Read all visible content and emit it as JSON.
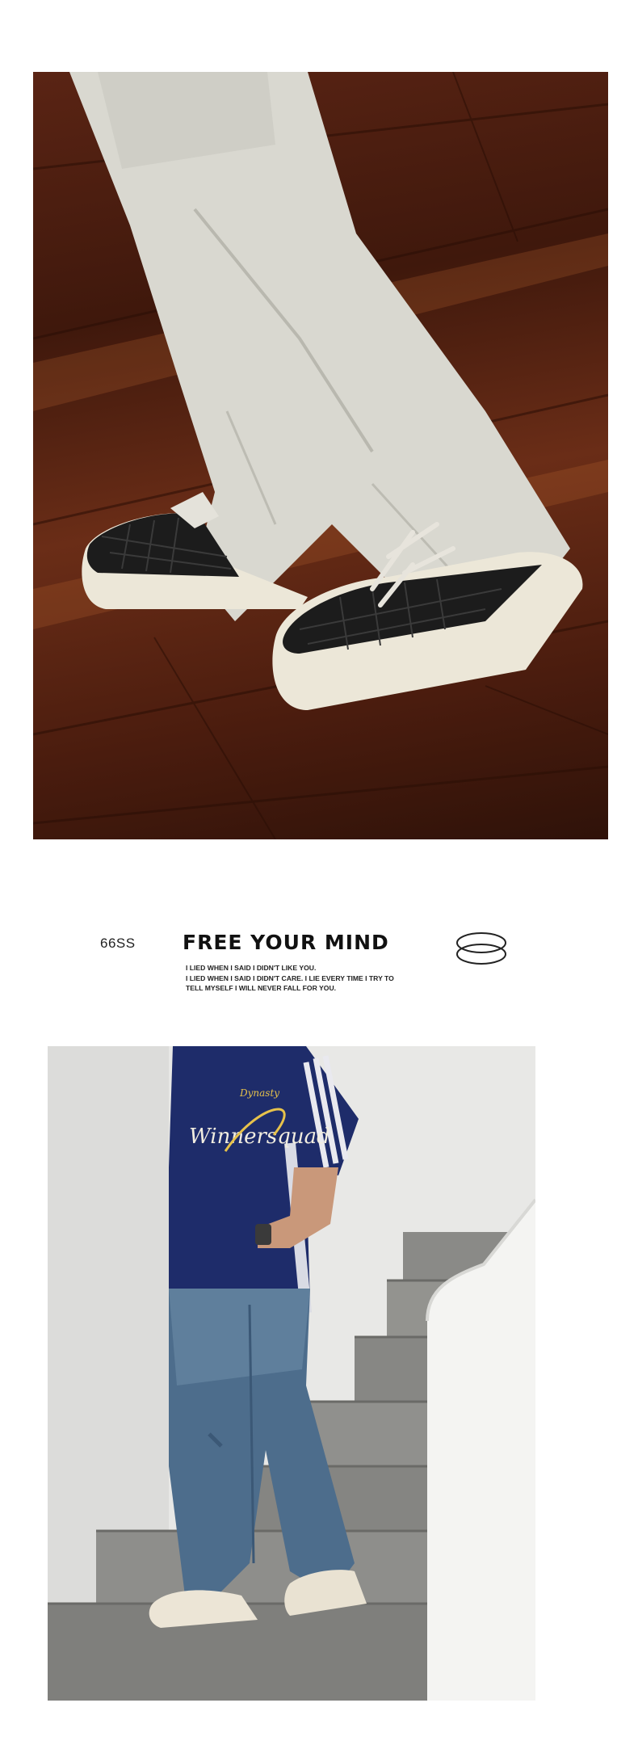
{
  "photos": [
    {
      "subject": "sneakers-photo",
      "alt": ""
    },
    {
      "subject": "stairs-outfit-photo",
      "alt": ""
    }
  ],
  "slogan": {
    "code": "66SS",
    "headline": "FREE YOUR MIND",
    "lines": [
      "I LIED WHEN I SAID I DIDN'T LIKE YOU.",
      "I LIED WHEN I SAID I DIDN'T CARE. I LIE EVERY TIME I TRY TO",
      "TELL MYSELF I WILL NEVER FALL FOR YOU."
    ]
  },
  "shirt_print": {
    "main": "Winnersquad",
    "badge": "Dynasty"
  },
  "colors": {
    "floor": "#4a1c0e",
    "pants_light": "#d9d8d0",
    "shoe_upper": "#1b1b1b",
    "sole": "#ece7d8",
    "jersey": "#1e2c6a",
    "jeans": "#4d6d8c",
    "stairs": "#8b8b88"
  }
}
